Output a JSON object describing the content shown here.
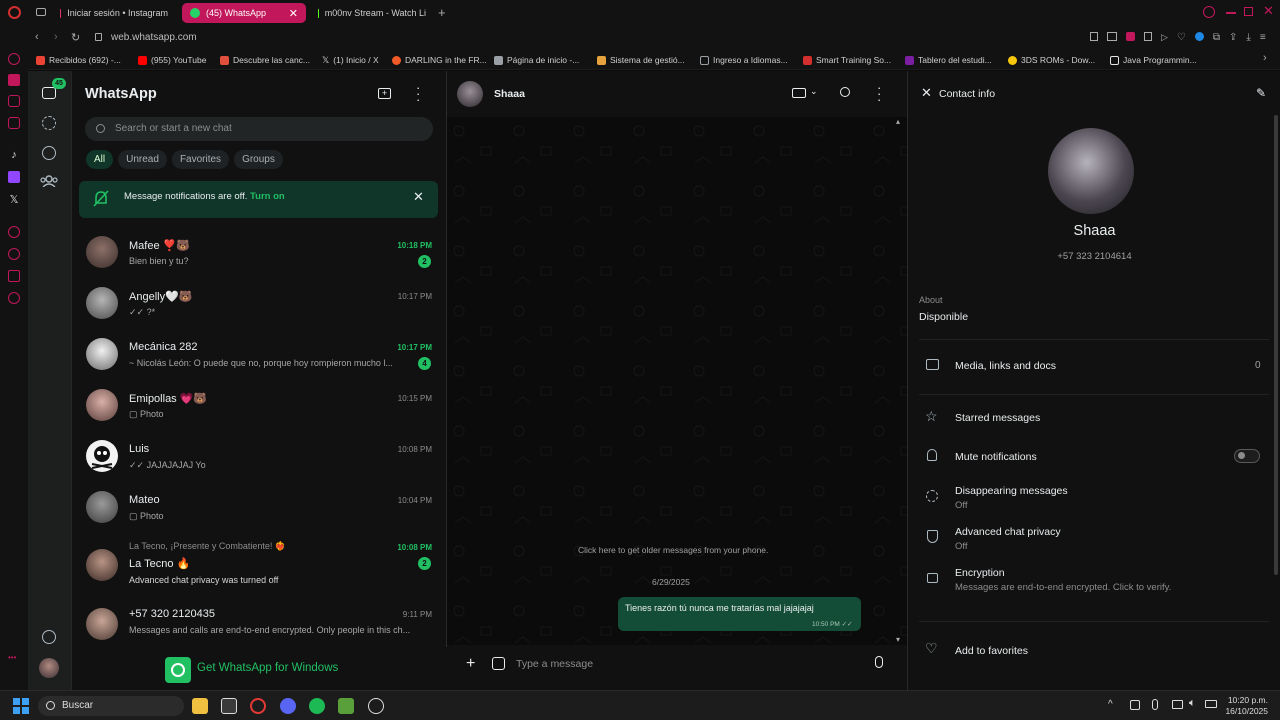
{
  "browser": {
    "tabs": [
      {
        "label": "Iniciar sesión • Instagram",
        "color": "#e1306c"
      },
      {
        "label": "(45) WhatsApp",
        "color": "#25d366",
        "active": true
      },
      {
        "label": "m00nv Stream - Watch Li",
        "color": "#53fc18"
      }
    ],
    "url": "web.whatsapp.com",
    "bookmarks": [
      {
        "label": "Recibidos (692) -...",
        "color": "#ea4335"
      },
      {
        "label": "(955) YouTube",
        "color": "#ff0000"
      },
      {
        "label": "Descubre las canc...",
        "color": "#e1503c"
      },
      {
        "label": "(1) Inicio / X",
        "color": "#ffffff"
      },
      {
        "label": "DARLING in the FR...",
        "color": "#f05a28"
      },
      {
        "label": "Página de inicio -...",
        "color": "#9aa0a6"
      },
      {
        "label": "Sistema de gestió...",
        "color": "#e6a23c"
      },
      {
        "label": "Ingreso a Idiomas...",
        "color": "#9aa0a6"
      },
      {
        "label": "Smart Training So...",
        "color": "#d32f2f"
      },
      {
        "label": "Tablero del estudi...",
        "color": "#7b1fa2"
      },
      {
        "label": "3DS ROMs - Dow...",
        "color": "#f9c70c"
      },
      {
        "label": "Java Programmin...",
        "color": "#e5e5e5"
      }
    ]
  },
  "rail": {
    "unread_count": "45"
  },
  "chatlist": {
    "title": "WhatsApp",
    "search_placeholder": "Search or start a new chat",
    "filters": [
      "All",
      "Unread",
      "Favorites",
      "Groups"
    ],
    "notice": {
      "text": "Message notifications are off.",
      "link": "Turn on"
    },
    "chats": [
      {
        "name": "Mafee ❣️🐻",
        "preview": "Bien bien y tu?",
        "time": "10:18 PM",
        "unread": "2",
        "avatar": "#6b5a55"
      },
      {
        "name": "Angelly🤍🐻",
        "preview": "✓✓ ?*",
        "time": "10:17 PM",
        "unread": "",
        "avatar": "#8a8a8a"
      },
      {
        "name": "Mecánica 282",
        "preview": "~ Nicolás León: O puede que no, porque hoy rompieron mucho l...",
        "time": "10:17 PM",
        "unread": "4",
        "avatar": "#cfcfcf"
      },
      {
        "name": "Emipollas 💗🐻",
        "preview": "▢ Photo",
        "time": "10:15 PM",
        "unread": "",
        "avatar": "#b38b80"
      },
      {
        "name": "Luis",
        "preview": "✓✓ JAJAJAJAJ Yo",
        "time": "10:08 PM",
        "unread": "",
        "avatar": "#f2f2f2"
      },
      {
        "name": "Mateo",
        "preview": "▢ Photo",
        "time": "10:04 PM",
        "unread": "",
        "avatar": "#7a7a7a"
      },
      {
        "name": "La Tecno 🔥",
        "group": "La Tecno, ¡Presente y Combatiente! ❤️‍🔥",
        "preview": "Advanced chat privacy was turned off",
        "time": "10:08 PM",
        "unread": "2",
        "avatar": "#9c7a6a"
      },
      {
        "name": "+57 320 2120435",
        "preview": "Messages and calls are end-to-end encrypted. Only people in this ch...",
        "time": "9:11 PM",
        "unread": "",
        "avatar": "#a58a7c"
      }
    ],
    "get_app": "Get WhatsApp for Windows"
  },
  "conversation": {
    "contact": "Shaaa",
    "older_hint": "Click here to get older messages from your phone.",
    "date": "6/29/2025",
    "message": {
      "text": "Tienes razón tú nunca me tratarías mal jajajajaj",
      "time": "10:50 PM"
    },
    "composer_placeholder": "Type a message"
  },
  "contact_info": {
    "header": "Contact info",
    "name": "Shaaa",
    "phone": "+57 323 2104614",
    "about_label": "About",
    "about": "Disponible",
    "media_label": "Media, links and docs",
    "media_count": "0",
    "starred": "Starred messages",
    "mute": "Mute notifications",
    "disappearing": "Disappearing messages",
    "disappearing_state": "Off",
    "privacy": "Advanced chat privacy",
    "privacy_state": "Off",
    "encryption": "Encryption",
    "encryption_sub": "Messages are end-to-end encrypted. Click to verify.",
    "favorites": "Add to favorites"
  },
  "taskbar": {
    "search": "Buscar",
    "time": "10:20 p.m.",
    "date": "16/10/2025"
  },
  "colors": {
    "accent": "#21c063",
    "bubble": "#144d37",
    "notice": "#103529"
  }
}
